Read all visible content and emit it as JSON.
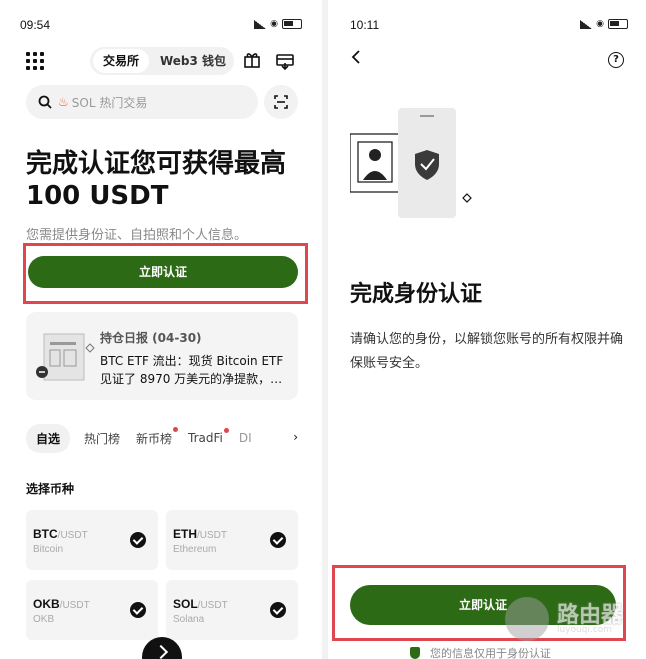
{
  "left": {
    "status": {
      "time": "09:54"
    },
    "header": {
      "seg_exchange": "交易所",
      "seg_web3": "Web3 钱包"
    },
    "search": {
      "placeholder": "SOL 热门交易"
    },
    "headline": "完成认证您可获得最高 100 USDT",
    "subtext": "您需提供身份证、自拍照和个人信息。",
    "verify_button": "立即认证",
    "report": {
      "title": "持仓日报 (04-30)",
      "body": "BTC ETF 流出：现货 Bitcoin ETF 见证了 8970 万美元的净提款，…"
    },
    "tabs": [
      {
        "label": "自选",
        "active": true,
        "dot": false
      },
      {
        "label": "热门榜",
        "active": false,
        "dot": false
      },
      {
        "label": "新币榜",
        "active": false,
        "dot": true
      },
      {
        "label": "TradFi",
        "active": false,
        "dot": true
      },
      {
        "label": "DI",
        "active": false,
        "dot": false
      }
    ],
    "coins_title": "选择币种",
    "coins": [
      {
        "symbol": "BTC",
        "pair": "/USDT",
        "name": "Bitcoin",
        "checked": true
      },
      {
        "symbol": "ETH",
        "pair": "/USDT",
        "name": "Ethereum",
        "checked": true
      },
      {
        "symbol": "OKB",
        "pair": "/USDT",
        "name": "OKB",
        "checked": true
      },
      {
        "symbol": "SOL",
        "pair": "/USDT",
        "name": "Solana",
        "checked": true
      }
    ]
  },
  "right": {
    "status": {
      "time": "10:11"
    },
    "headline": "完成身份认证",
    "description": "请确认您的身份，以解锁您账号的所有权限并确保账号安全。",
    "verify_button": "立即认证",
    "privacy_note": "您的信息仅用于身份认证"
  },
  "watermark": {
    "text": "路由器",
    "url": "luyouqi.com"
  },
  "colors": {
    "brand_green": "#2d6a16",
    "highlight_red": "#e0464e",
    "notice_dot": "#e0464e"
  },
  "icons": {
    "apps": "apps-grid-icon",
    "gift": "gift-icon",
    "deposit": "deposit-icon",
    "search": "search-icon",
    "fire": "fire-icon",
    "scan": "scan-icon",
    "back": "back-icon",
    "help": "help-icon",
    "shield": "shield-icon",
    "check": "check-icon"
  }
}
